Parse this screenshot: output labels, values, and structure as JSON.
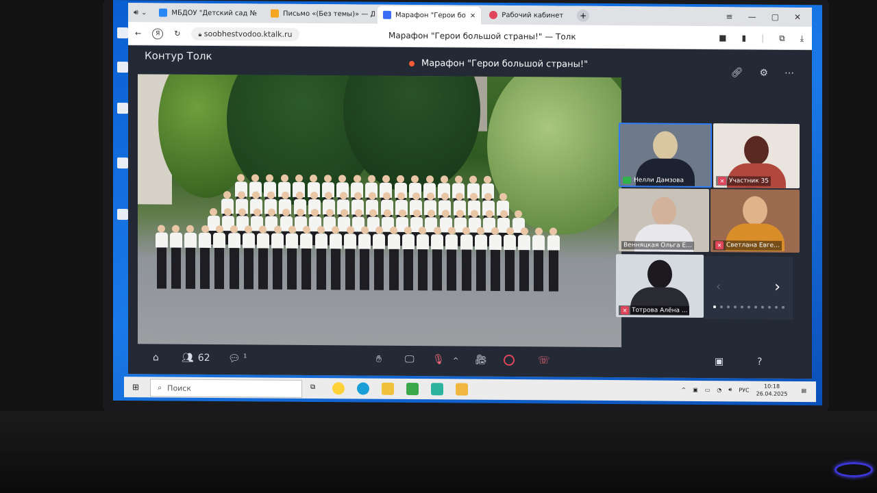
{
  "browser": {
    "tabs": [
      {
        "label": "МБДОУ \"Детский сад № ",
        "favicon": "vk-icon",
        "color": "#2787f5"
      },
      {
        "label": "Письмо «(Без темы)» — Д",
        "favicon": "mail-icon",
        "color": "#f5a623"
      },
      {
        "label": "Марафон \"Герои бо",
        "favicon": "ktalk-icon",
        "color": "#3b6cf6",
        "active": true
      },
      {
        "label": "Рабочий кабинет",
        "favicon": "workspace-icon",
        "color": "#e0465b"
      }
    ],
    "url": "soobhestvodoo.ktalk.ru",
    "page_heading": "Марафон \"Герои большой страны!\" — Толк"
  },
  "app": {
    "name": "Контур Толк",
    "meeting_title": "Марафон \"Герои большой страны!\""
  },
  "participants": [
    {
      "name": "Нелли Дамзова",
      "status": "screen-share-icon",
      "active": true
    },
    {
      "name": "Участник 35",
      "status": "mic-off-icon"
    },
    {
      "name": "Венняцкая Ольга Е...",
      "status": ""
    },
    {
      "name": "Светлана Евге...",
      "status": "mic-off-icon"
    },
    {
      "name": "Тотрова Алёна ...",
      "status": "mic-off-icon"
    }
  ],
  "toolbar": {
    "participant_count": "62",
    "chat_badge": "1",
    "help": "?"
  },
  "taskbar": {
    "search_placeholder": "Поиск",
    "language": "РУС",
    "time": "10:18",
    "date": "26.04.2025",
    "notification_count": "1"
  },
  "colors": {
    "app_bg": "#232a36",
    "accent": "#3b6cf6",
    "record": "#ff5a36",
    "mic_off": "#e0465b"
  }
}
